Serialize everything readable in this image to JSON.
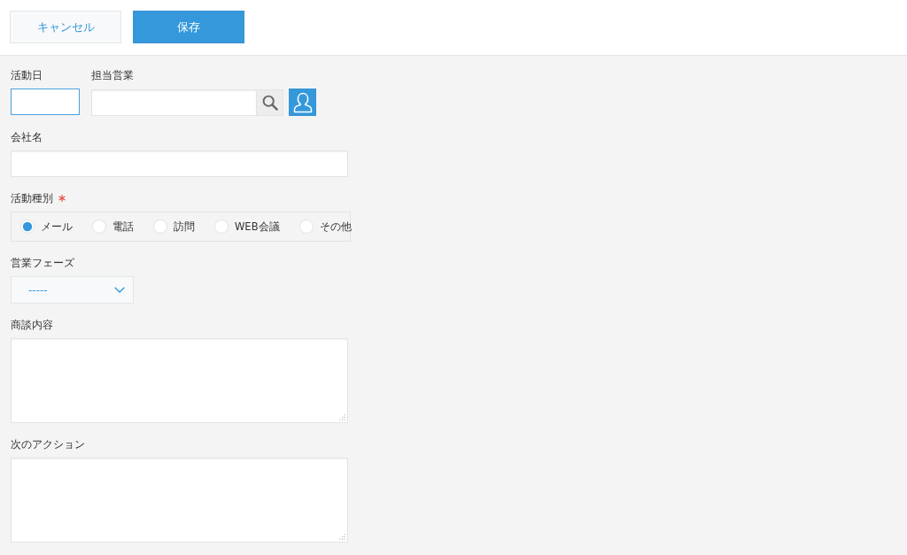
{
  "toolbar": {
    "buttons": [
      {
        "label": "キャンセル",
        "kind": "cancel"
      },
      {
        "label": "保存",
        "kind": "save"
      }
    ]
  },
  "form": {
    "rows": [
      {
        "fields": [
          {
            "kind": "date",
            "label": "活動日",
            "required": false,
            "focused": true
          },
          {
            "kind": "user",
            "label": "担当営業",
            "required": false,
            "focused": false
          }
        ]
      },
      {
        "fields": [
          {
            "kind": "text",
            "label": "会社名",
            "required": false,
            "focused": false
          }
        ]
      },
      {
        "fields": [
          {
            "kind": "radio",
            "label": "活動種別",
            "required": true,
            "focused": false,
            "options": [
              {
                "label": "メール",
                "selected": true
              },
              {
                "label": "電話",
                "selected": false
              },
              {
                "label": "訪問",
                "selected": false
              },
              {
                "label": "WEB会議",
                "selected": false
              },
              {
                "label": "その他",
                "selected": false
              }
            ]
          }
        ]
      },
      {
        "fields": [
          {
            "kind": "select",
            "label": "営業フェーズ",
            "required": false,
            "focused": false,
            "value": "-----"
          }
        ]
      },
      {
        "fields": [
          {
            "kind": "textarea",
            "label": "商談内容",
            "required": false,
            "focused": false
          }
        ]
      },
      {
        "fields": [
          {
            "kind": "textarea",
            "label": "次のアクション",
            "required": false,
            "focused": false
          }
        ]
      }
    ]
  }
}
